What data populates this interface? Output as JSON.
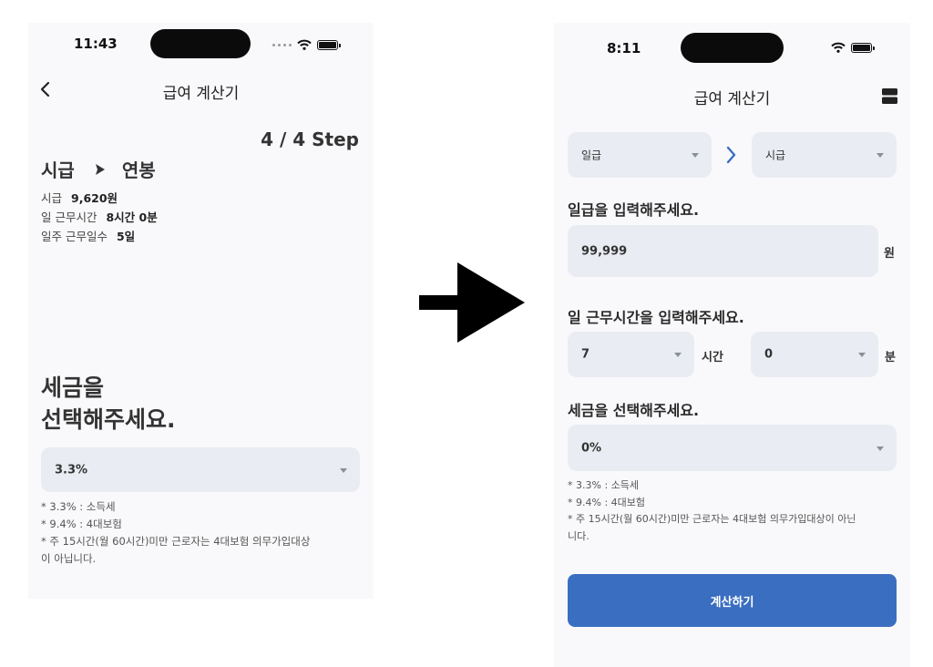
{
  "left_screen": {
    "status_time": "11:43",
    "nav_title": "급여 계산기",
    "step": "4 / 4 Step",
    "conversion": {
      "from": "시급",
      "to": "연봉"
    },
    "summary": [
      {
        "label": "시급",
        "value": "9,620원"
      },
      {
        "label": "일 근무시간",
        "value": "8시간 0분"
      },
      {
        "label": "일주 근무일수",
        "value": "5일"
      }
    ],
    "heading_line1": "세금을",
    "heading_line2": "선택해주세요.",
    "tax_select_value": "3.3%",
    "notes": [
      "* 3.3% : 소득세",
      "* 9.4% : 4대보험",
      "* 주 15시간(월 60시간)미만 근로자는 4대보험 의무가입대상",
      "이 아닙니다."
    ]
  },
  "right_screen": {
    "status_time": "8:11",
    "nav_title": "급여 계산기",
    "from_unit": "일급",
    "to_unit": "시급",
    "wage_prompt": "일급을 입력해주세요.",
    "wage_value": "99,999",
    "wage_unit": "원",
    "hours_prompt": "일 근무시간을 입력해주세요.",
    "hours_value": "7",
    "hours_unit": "시간",
    "minutes_value": "0",
    "minutes_unit": "분",
    "tax_prompt": "세금을 선택해주세요.",
    "tax_select_value": "0%",
    "notes": [
      "* 3.3% : 소득세",
      "* 9.4% : 4대보험",
      "* 주 15시간(월 60시간)미만 근로자는 4대보험 의무가입대상이 아닌",
      "니다."
    ],
    "calc_button": "계산하기"
  },
  "icons": {
    "back": "chevron-left-icon",
    "play": "play-triangle-icon",
    "menu": "menu-icon",
    "arrow": "chevron-right-icon",
    "transition": "right-arrow-icon"
  },
  "colors": {
    "primary": "#3a6ec1",
    "field_bg": "#e9ecf2",
    "screen_bg": "#f9f9fb"
  }
}
